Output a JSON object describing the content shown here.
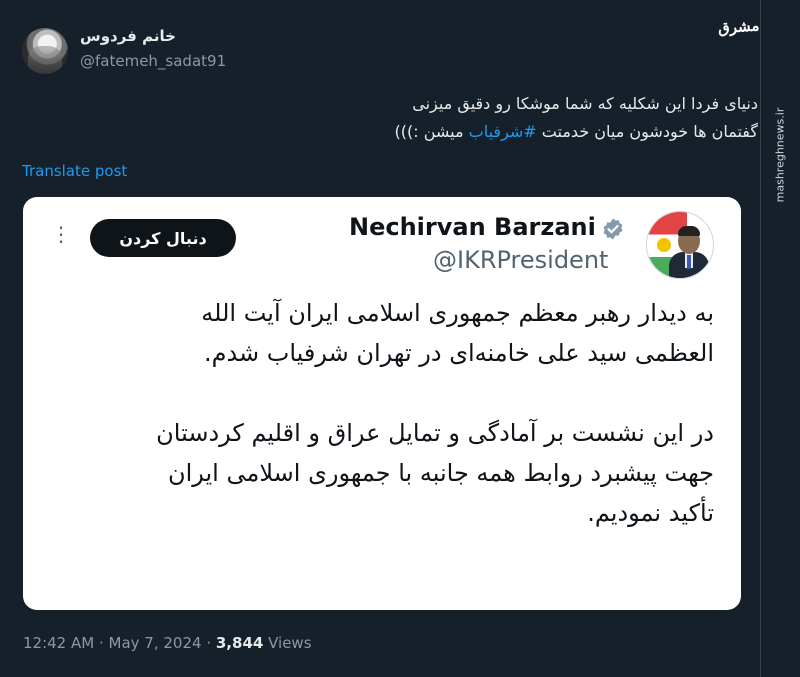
{
  "watermark": {
    "logo_text": "مشرق",
    "site_text": "mashreghnews.ir"
  },
  "author": {
    "display_name": "خانم فردوس",
    "handle": "@fatemeh_sadat91"
  },
  "tweet": {
    "line1": "دنیای فردا این شکلیه که شما موشکا رو دقیق میزنی",
    "line2_prefix": "گفتمان ها خودشون میان خدمتت ",
    "hashtag": "#شرفیاب",
    "line2_suffix": " میشن :)))"
  },
  "translate_label": "Translate post",
  "quoted": {
    "name": "Nechirvan Barzani",
    "handle": "@IKRPresident",
    "follow_label": "دنبال کردن",
    "paragraph1_line1": "به دیدار رهبر معظم جمهوری اسلامی ایران آیت الله",
    "paragraph1_line2": "العظمی سید علی خامنه‌ای در تهران شرفیاب شدم.",
    "paragraph2_line1": "در این نشست  بر آمادگی و تمایل عراق و اقلیم کردستان",
    "paragraph2_line2": "جهت پیشبرد روابط همه جانبه با جمهوری اسلامی ایران",
    "paragraph2_line3": "تأکید نمودیم."
  },
  "meta": {
    "time": "12:42 AM",
    "separator": " · ",
    "date": "May 7, 2024",
    "views_count": "3,844",
    "views_label": " Views"
  },
  "icons": {
    "verified": "verified-badge-icon",
    "more": "more-options-icon"
  },
  "colors": {
    "background": "#15202b",
    "accent": "#1d9bf0",
    "card": "#ffffff",
    "verified": "#829aab"
  }
}
